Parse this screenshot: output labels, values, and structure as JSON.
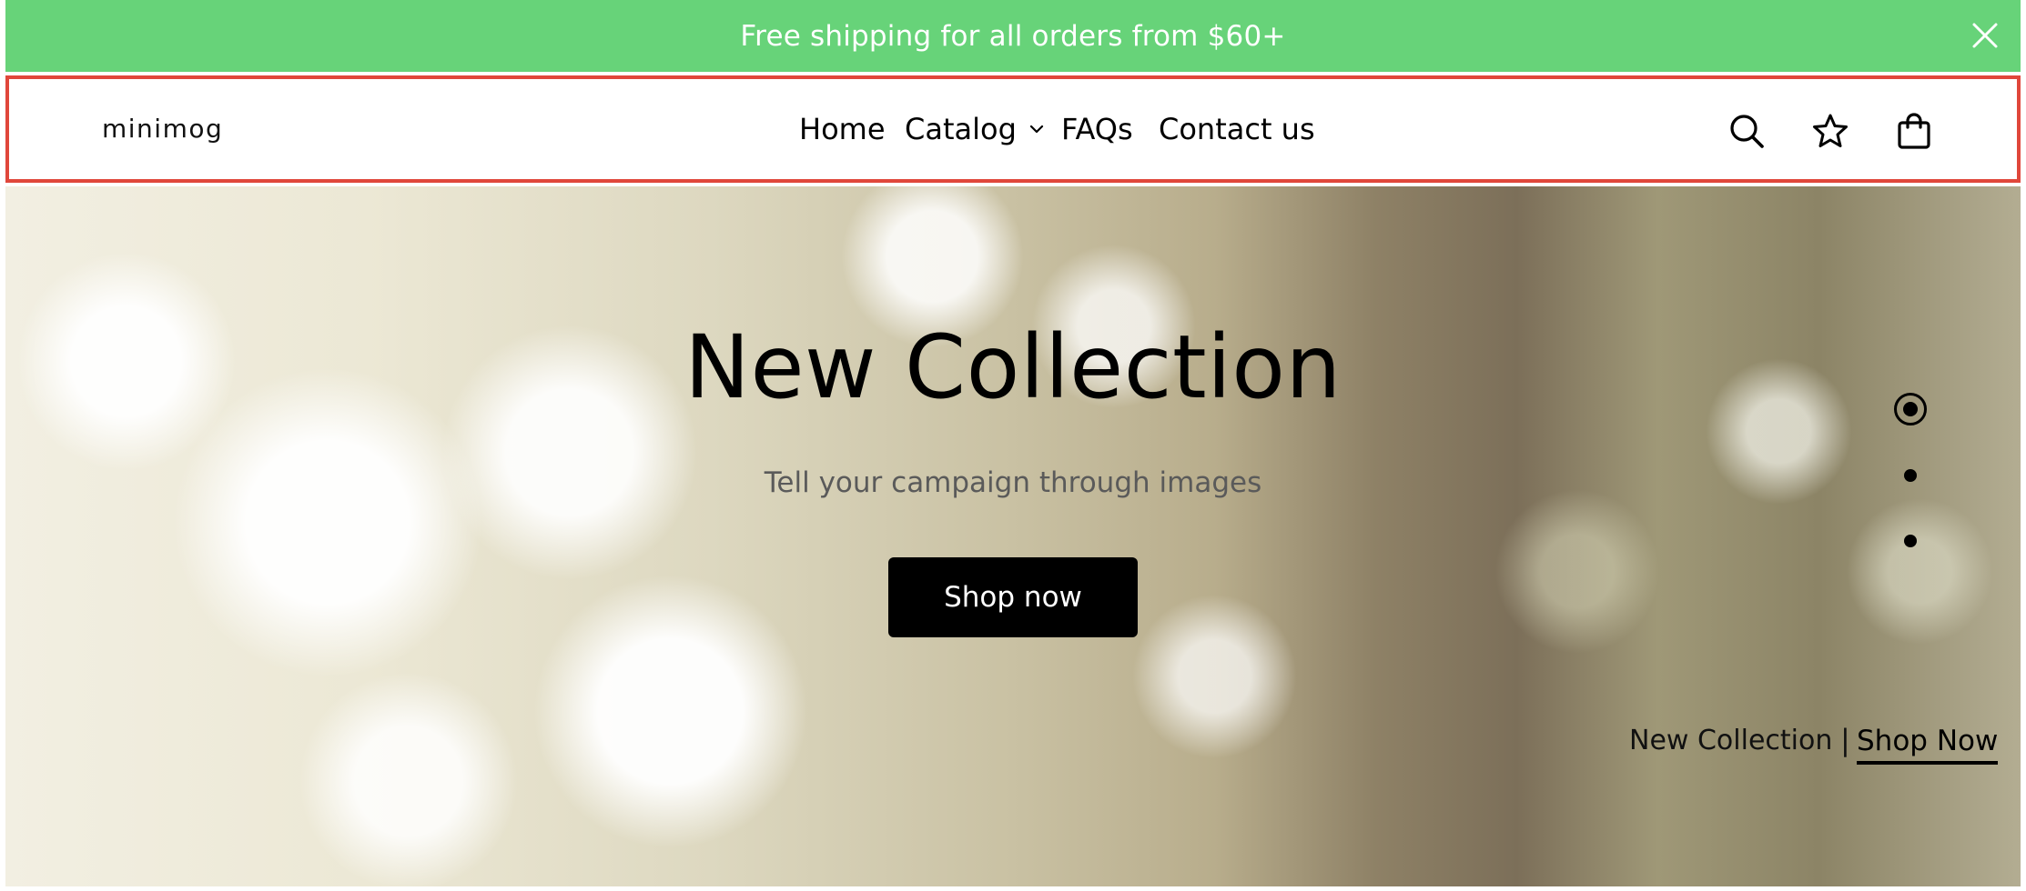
{
  "announcement": {
    "text": "Free shipping for all orders from $60+",
    "background": "#67d379",
    "close_icon": "close-icon"
  },
  "header": {
    "logo": "minimog",
    "border_color": "#e0473b",
    "nav": [
      {
        "label": "Home"
      },
      {
        "label": "Catalog",
        "icon": "chevron-down-icon"
      },
      {
        "label": "FAQs"
      },
      {
        "label": "Contact us"
      }
    ],
    "icons": [
      "search-icon",
      "star-icon",
      "shopping-bag-icon"
    ]
  },
  "hero": {
    "title": "New Collection",
    "subtitle": "Tell your campaign through images",
    "button_label": "Shop now",
    "slides": {
      "total": 3,
      "active": 1
    },
    "caption": "New Collection",
    "separator": "|",
    "caption_link": "Shop Now"
  }
}
